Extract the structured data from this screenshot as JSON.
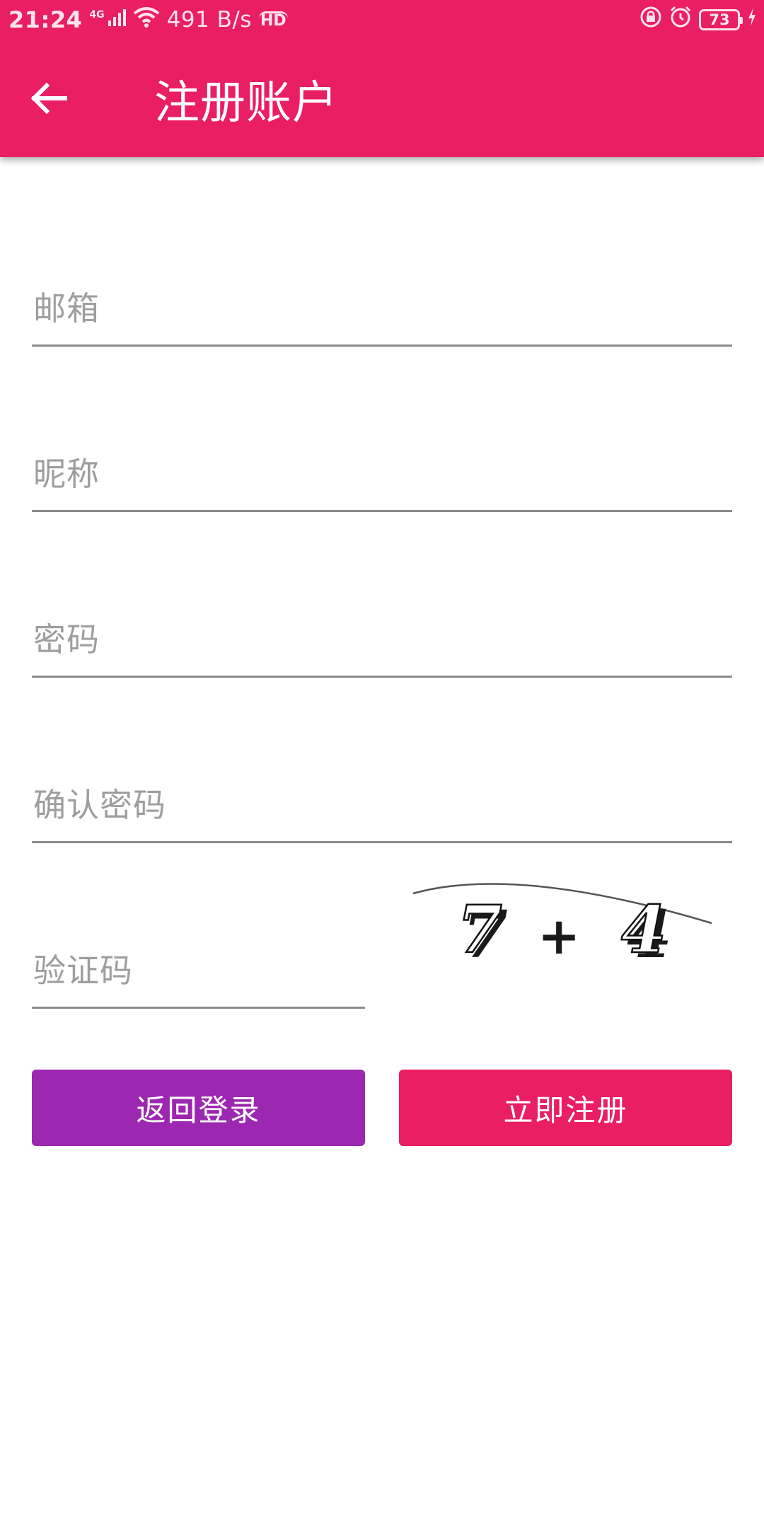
{
  "colors": {
    "primary": "#E91E63",
    "accent_purple": "#9C27B0",
    "hint_text": "#9E9E9E",
    "underline": "#8A8A8A"
  },
  "status_bar": {
    "time": "21:24",
    "network_label": "4G",
    "speed": "491 B/s",
    "hd_label": "HD",
    "battery_level": "73",
    "icons": [
      "signal-icon",
      "wifi-icon",
      "hd-icon",
      "lock-rotation-icon",
      "alarm-icon",
      "battery-icon",
      "charging-icon"
    ]
  },
  "toolbar": {
    "back_icon": "arrow-left-icon",
    "title": "注册账户"
  },
  "form": {
    "email_hint": "邮箱",
    "nickname_hint": "昵称",
    "password_hint": "密码",
    "confirm_password_hint": "确认密码",
    "captcha_hint": "验证码"
  },
  "captcha": {
    "left_operand": "7",
    "operator": "+",
    "right_operand": "4"
  },
  "buttons": {
    "back_to_login": "返回登录",
    "register_now": "立即注册"
  }
}
